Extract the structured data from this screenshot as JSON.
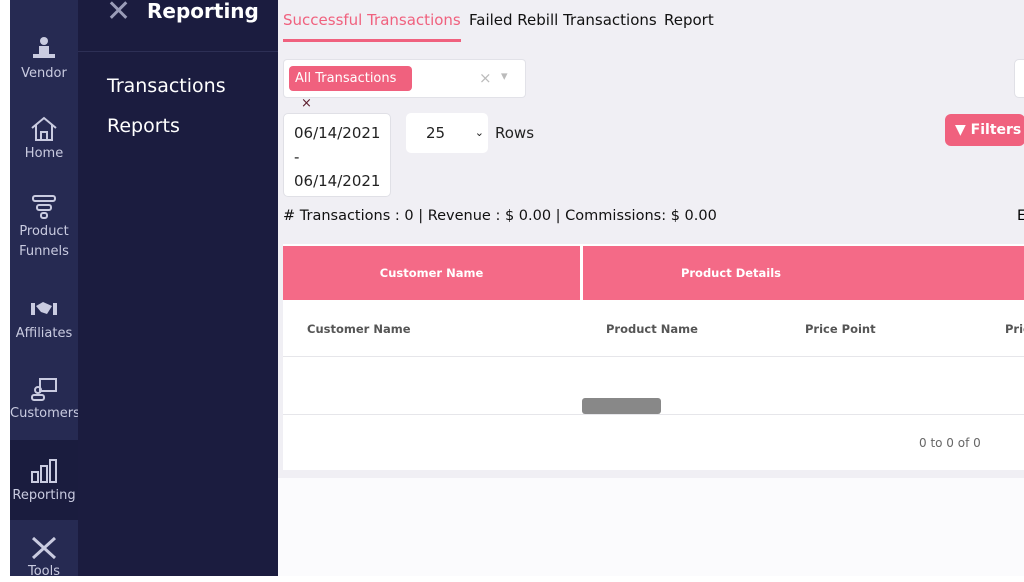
{
  "rail": {
    "items": [
      {
        "label": "Vendor",
        "icon": "vendor-icon"
      },
      {
        "label": "Home",
        "icon": "home-icon"
      },
      {
        "label": "Product Funnels",
        "icon": "funnel-icon"
      },
      {
        "label": "Affiliates",
        "icon": "handshake-icon"
      },
      {
        "label": "Customers",
        "icon": "customers-icon"
      },
      {
        "label": "Reporting",
        "icon": "bar-chart-icon",
        "active": true
      },
      {
        "label": "Tools",
        "icon": "tools-icon"
      }
    ]
  },
  "panel": {
    "title": "Reporting",
    "items": [
      "Transactions",
      "Reports"
    ]
  },
  "tabs": [
    {
      "label": "Successful Transactions",
      "active": true
    },
    {
      "label": "Failed Rebill Transactions"
    },
    {
      "label": "Report"
    }
  ],
  "filter": {
    "chip": "All Transactions",
    "chip_remove": "×",
    "clear": "×",
    "dropdown": "▾"
  },
  "date_range": {
    "start": "06/14/2021",
    "sep": "-",
    "end": "06/14/2021"
  },
  "rows": {
    "value": "25",
    "label": "Rows"
  },
  "filters_button": "Filters",
  "stats": "# Transactions : 0 | Revenue : $ 0.00 | Commissions: $ 0.00",
  "stats_right": "E",
  "table": {
    "groups": [
      "Customer Name",
      "Product Details"
    ],
    "columns": [
      "Customer Name",
      "Product Name",
      "Price Point",
      "Pric"
    ],
    "pagination": "0 to 0 of 0"
  },
  "colors": {
    "accent": "#f0617e",
    "rail": "#262a52",
    "panel": "#1b1c3f"
  }
}
